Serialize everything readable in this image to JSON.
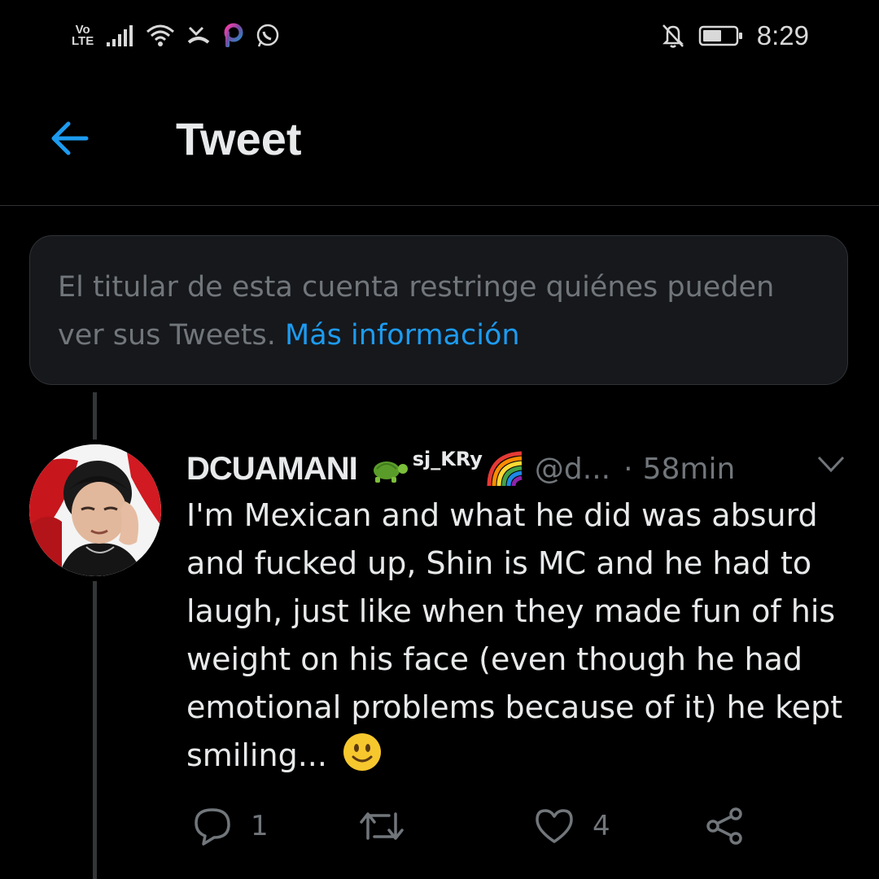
{
  "status_bar": {
    "volte_top": "Vo",
    "volte_bottom": "LTE",
    "time": "8:29",
    "left_icons": [
      "signal-bars-icon",
      "wifi-icon",
      "missed-call-icon",
      "picsart-icon",
      "whatsapp-icon"
    ],
    "right_icons": [
      "notifications-off-icon",
      "battery-icon"
    ]
  },
  "header": {
    "title": "Tweet",
    "back_icon": "arrow-left-icon"
  },
  "notice": {
    "text": "El titular de esta cuenta restringe quiénes pueden ver sus Tweets. ",
    "link": "Más información"
  },
  "tweet": {
    "author_name": "DCUAMANI",
    "author_name_suffix": "sj_KRy",
    "handle": "@d...",
    "separator": "·",
    "time": "58min",
    "text": "I'm Mexican and what he did was absurd and fucked up, Shin is MC and he had to laugh, just like when they made fun of his weight on his face (even though he had emotional problems because of it) he kept smiling...",
    "emojis": [
      "turtle-emoji",
      "rainbow-emoji",
      "smiling-face-emoji"
    ],
    "actions": {
      "reply_count": "1",
      "retweet_count": "",
      "like_count": "4"
    }
  },
  "colors": {
    "background": "#000000",
    "accent": "#1d9bf0",
    "muted": "#71767b",
    "divider": "#2f3336"
  }
}
